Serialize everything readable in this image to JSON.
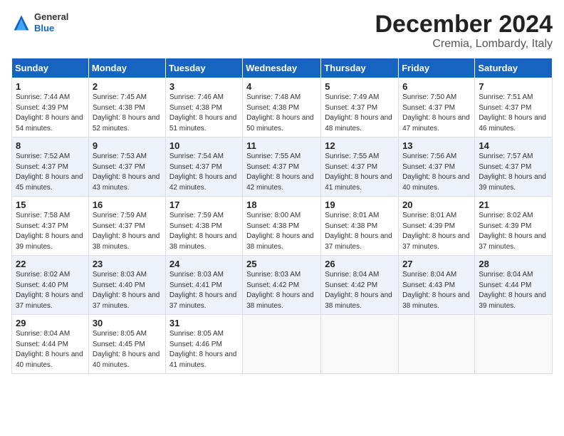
{
  "header": {
    "logo_general": "General",
    "logo_blue": "Blue",
    "month_title": "December 2024",
    "location": "Cremia, Lombardy, Italy"
  },
  "weekdays": [
    "Sunday",
    "Monday",
    "Tuesday",
    "Wednesday",
    "Thursday",
    "Friday",
    "Saturday"
  ],
  "weeks": [
    [
      {
        "day": "1",
        "sunrise": "7:44 AM",
        "sunset": "4:39 PM",
        "daylight": "8 hours and 54 minutes."
      },
      {
        "day": "2",
        "sunrise": "7:45 AM",
        "sunset": "4:38 PM",
        "daylight": "8 hours and 52 minutes."
      },
      {
        "day": "3",
        "sunrise": "7:46 AM",
        "sunset": "4:38 PM",
        "daylight": "8 hours and 51 minutes."
      },
      {
        "day": "4",
        "sunrise": "7:48 AM",
        "sunset": "4:38 PM",
        "daylight": "8 hours and 50 minutes."
      },
      {
        "day": "5",
        "sunrise": "7:49 AM",
        "sunset": "4:37 PM",
        "daylight": "8 hours and 48 minutes."
      },
      {
        "day": "6",
        "sunrise": "7:50 AM",
        "sunset": "4:37 PM",
        "daylight": "8 hours and 47 minutes."
      },
      {
        "day": "7",
        "sunrise": "7:51 AM",
        "sunset": "4:37 PM",
        "daylight": "8 hours and 46 minutes."
      }
    ],
    [
      {
        "day": "8",
        "sunrise": "7:52 AM",
        "sunset": "4:37 PM",
        "daylight": "8 hours and 45 minutes."
      },
      {
        "day": "9",
        "sunrise": "7:53 AM",
        "sunset": "4:37 PM",
        "daylight": "8 hours and 43 minutes."
      },
      {
        "day": "10",
        "sunrise": "7:54 AM",
        "sunset": "4:37 PM",
        "daylight": "8 hours and 42 minutes."
      },
      {
        "day": "11",
        "sunrise": "7:55 AM",
        "sunset": "4:37 PM",
        "daylight": "8 hours and 42 minutes."
      },
      {
        "day": "12",
        "sunrise": "7:55 AM",
        "sunset": "4:37 PM",
        "daylight": "8 hours and 41 minutes."
      },
      {
        "day": "13",
        "sunrise": "7:56 AM",
        "sunset": "4:37 PM",
        "daylight": "8 hours and 40 minutes."
      },
      {
        "day": "14",
        "sunrise": "7:57 AM",
        "sunset": "4:37 PM",
        "daylight": "8 hours and 39 minutes."
      }
    ],
    [
      {
        "day": "15",
        "sunrise": "7:58 AM",
        "sunset": "4:37 PM",
        "daylight": "8 hours and 39 minutes."
      },
      {
        "day": "16",
        "sunrise": "7:59 AM",
        "sunset": "4:37 PM",
        "daylight": "8 hours and 38 minutes."
      },
      {
        "day": "17",
        "sunrise": "7:59 AM",
        "sunset": "4:38 PM",
        "daylight": "8 hours and 38 minutes."
      },
      {
        "day": "18",
        "sunrise": "8:00 AM",
        "sunset": "4:38 PM",
        "daylight": "8 hours and 38 minutes."
      },
      {
        "day": "19",
        "sunrise": "8:01 AM",
        "sunset": "4:38 PM",
        "daylight": "8 hours and 37 minutes."
      },
      {
        "day": "20",
        "sunrise": "8:01 AM",
        "sunset": "4:39 PM",
        "daylight": "8 hours and 37 minutes."
      },
      {
        "day": "21",
        "sunrise": "8:02 AM",
        "sunset": "4:39 PM",
        "daylight": "8 hours and 37 minutes."
      }
    ],
    [
      {
        "day": "22",
        "sunrise": "8:02 AM",
        "sunset": "4:40 PM",
        "daylight": "8 hours and 37 minutes."
      },
      {
        "day": "23",
        "sunrise": "8:03 AM",
        "sunset": "4:40 PM",
        "daylight": "8 hours and 37 minutes."
      },
      {
        "day": "24",
        "sunrise": "8:03 AM",
        "sunset": "4:41 PM",
        "daylight": "8 hours and 37 minutes."
      },
      {
        "day": "25",
        "sunrise": "8:03 AM",
        "sunset": "4:42 PM",
        "daylight": "8 hours and 38 minutes."
      },
      {
        "day": "26",
        "sunrise": "8:04 AM",
        "sunset": "4:42 PM",
        "daylight": "8 hours and 38 minutes."
      },
      {
        "day": "27",
        "sunrise": "8:04 AM",
        "sunset": "4:43 PM",
        "daylight": "8 hours and 38 minutes."
      },
      {
        "day": "28",
        "sunrise": "8:04 AM",
        "sunset": "4:44 PM",
        "daylight": "8 hours and 39 minutes."
      }
    ],
    [
      {
        "day": "29",
        "sunrise": "8:04 AM",
        "sunset": "4:44 PM",
        "daylight": "8 hours and 40 minutes."
      },
      {
        "day": "30",
        "sunrise": "8:05 AM",
        "sunset": "4:45 PM",
        "daylight": "8 hours and 40 minutes."
      },
      {
        "day": "31",
        "sunrise": "8:05 AM",
        "sunset": "4:46 PM",
        "daylight": "8 hours and 41 minutes."
      },
      null,
      null,
      null,
      null
    ]
  ]
}
